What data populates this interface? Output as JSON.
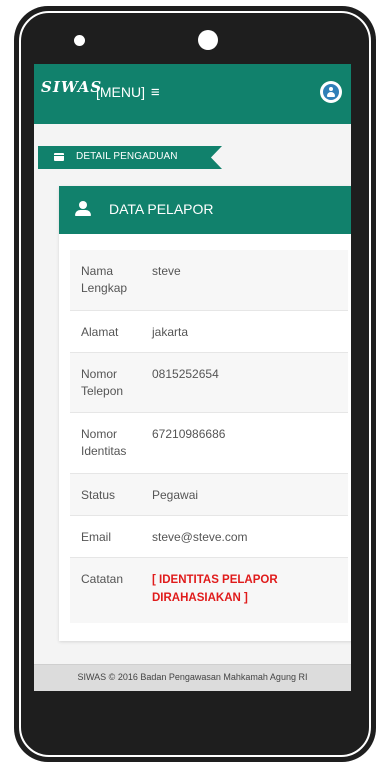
{
  "app": {
    "logo_text": "SIWAS",
    "menu_label": "[MENU]",
    "menu_icon": "hamburger-icon",
    "user_icon": "user-circle-icon"
  },
  "breadcrumb": {
    "label": "DETAIL PENGADUAN",
    "icon": "folder-icon"
  },
  "card": {
    "title": "DATA PELAPOR",
    "icon": "person-icon"
  },
  "details": [
    {
      "key": "Nama Lengkap",
      "value": "steve"
    },
    {
      "key": "Alamat",
      "value": "jakarta"
    },
    {
      "key": "Nomor Telepon",
      "value": "0815252654"
    },
    {
      "key": "Nomor Identitas",
      "value": "67210986686"
    },
    {
      "key": "Status",
      "value": "Pegawai"
    },
    {
      "key": "Email",
      "value": "steve@steve.com"
    },
    {
      "key": "Catatan",
      "value": "[ IDENTITAS PELAPOR DIRAHASIAKAN ]"
    }
  ],
  "footer": {
    "text": "SIWAS © 2016 Badan Pengawasan Mahkamah Agung RI"
  },
  "colors": {
    "primary": "#11816c",
    "secret": "#e01b1b",
    "background": "#f4f4f4"
  }
}
